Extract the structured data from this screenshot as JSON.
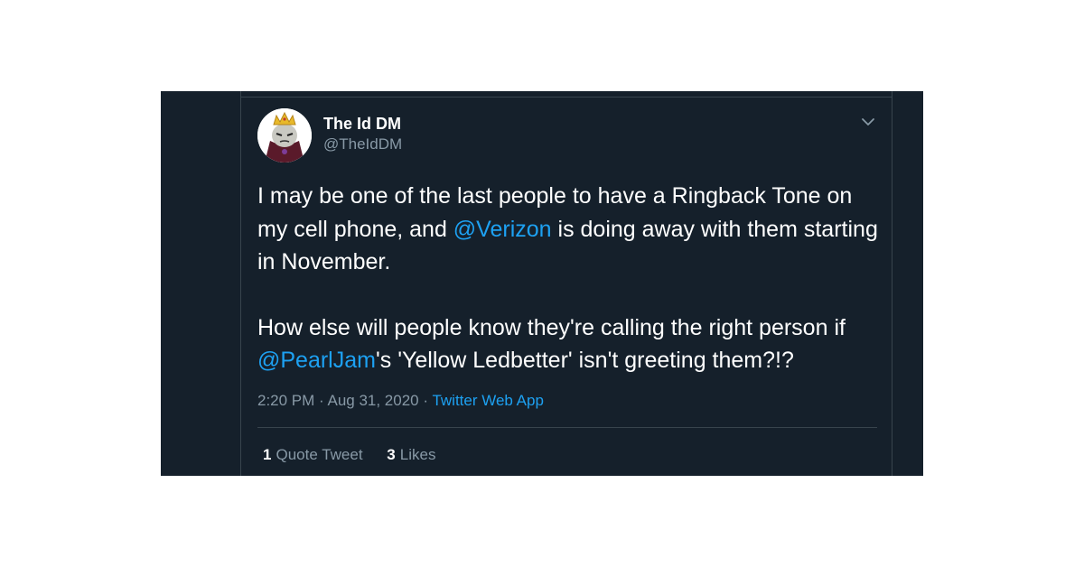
{
  "tweet": {
    "display_name": "The Id DM",
    "handle": "@TheIdDM",
    "body": {
      "p1_part1": "I may be one of the last people to have a Ringback Tone on my cell phone, and ",
      "p1_mention": "@Verizon",
      "p1_part2": " is doing away with them starting in November.",
      "p2_part1": "How else will people know they're calling the right person if ",
      "p2_mention": "@PearlJam",
      "p2_part2": "'s 'Yellow Ledbetter' isn't greeting them?!?"
    },
    "time": "2:20 PM",
    "date": "Aug 31, 2020",
    "separator": " · ",
    "source": "Twitter Web App",
    "quote_tweets_count": "1",
    "quote_tweets_label": "Quote Tweet",
    "likes_count": "3",
    "likes_label": "Likes"
  },
  "icons": {
    "menu": "chevron-down-icon",
    "avatar": "avatar"
  },
  "colors": {
    "background": "#15202b",
    "border": "#38444d",
    "text": "#ffffff",
    "secondary": "#8899a6",
    "accent": "#1da1f2"
  }
}
